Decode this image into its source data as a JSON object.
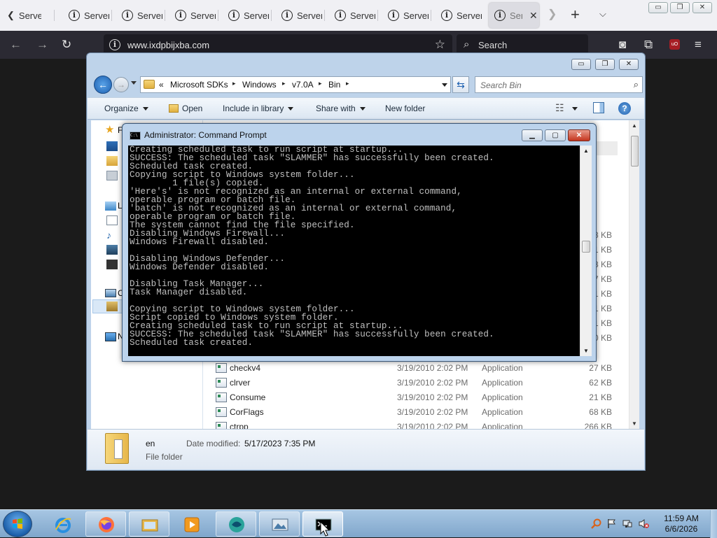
{
  "browser": {
    "tabs": [
      {
        "label": "Server"
      },
      {
        "label": "Server"
      },
      {
        "label": "Server"
      },
      {
        "label": "Server"
      },
      {
        "label": "Server"
      },
      {
        "label": "Server"
      },
      {
        "label": "Server"
      },
      {
        "label": "Server"
      },
      {
        "label": "Server"
      },
      {
        "label": "Ser",
        "active": true
      }
    ],
    "url": "www.ixdpbijxba.com",
    "search_placeholder": "Search"
  },
  "explorer": {
    "breadcrumb": [
      "«",
      "Microsoft SDKs",
      "Windows",
      "v7.0A",
      "Bin"
    ],
    "search_placeholder": "Search Bin",
    "toolbar": {
      "organize": "Organize",
      "open": "Open",
      "include_in_library": "Include in library",
      "share_with": "Share with",
      "new_folder": "New folder"
    },
    "nav_letters": [
      "F",
      "L",
      "C",
      "N"
    ],
    "partial_sizes": [
      "8 KB",
      "1 KB",
      "8 KB",
      "7 KB",
      "1 KB",
      "1 KB",
      "1 KB",
      "0 KB"
    ],
    "files": [
      {
        "name": "checkv4",
        "date": "3/19/2010 2:02 PM",
        "type": "Application",
        "size": "27 KB"
      },
      {
        "name": "clrver",
        "date": "3/19/2010 2:02 PM",
        "type": "Application",
        "size": "62 KB"
      },
      {
        "name": "Consume",
        "date": "3/19/2010 2:02 PM",
        "type": "Application",
        "size": "21 KB"
      },
      {
        "name": "CorFlags",
        "date": "3/19/2010 2:02 PM",
        "type": "Application",
        "size": "68 KB"
      },
      {
        "name": "ctrpp",
        "date": "3/19/2010 2:02 PM",
        "type": "Application",
        "size": "266 KB"
      }
    ],
    "details": {
      "name": "en",
      "type": "File folder",
      "date_label": "Date modified:",
      "date_value": "5/17/2023 7:35 PM"
    }
  },
  "cmd": {
    "title": "Administrator: Command Prompt",
    "lines": [
      "Creating scheduled task to run script at startup...",
      "SUCCESS: The scheduled task \"SLAMMER\" has successfully been created.",
      "Scheduled task created.",
      "Copying script to Windows system folder...",
      "        1 file(s) copied.",
      "'Here's' is not recognized as an internal or external command,",
      "operable program or batch file.",
      "'batch' is not recognized as an internal or external command,",
      "operable program or batch file.",
      "The system cannot find the file specified.",
      "Disabling Windows Firewall...",
      "Windows Firewall disabled.",
      "",
      "Disabling Windows Defender...",
      "Windows Defender disabled.",
      "",
      "Disabling Task Manager...",
      "Task Manager disabled.",
      "",
      "Copying script to Windows system folder...",
      "Script copied to Windows system folder.",
      "Creating scheduled task to run script at startup...",
      "SUCCESS: The scheduled task \"SLAMMER\" has successfully been created.",
      "Scheduled task created."
    ]
  },
  "taskbar": {
    "apps": [
      "internet-explorer",
      "firefox",
      "file-explorer",
      "media-player",
      "browser-app",
      "image-viewer",
      "command-prompt"
    ],
    "clock_time": "11:59 AM",
    "clock_date": "6/6/2026"
  },
  "colors": {
    "browser_tabbar": "#f0f0f4",
    "browser_navbar": "#2b2a33",
    "console_bg": "#000000",
    "console_fg": "#c0c0c0",
    "taskbar": "#8fb3d6"
  }
}
